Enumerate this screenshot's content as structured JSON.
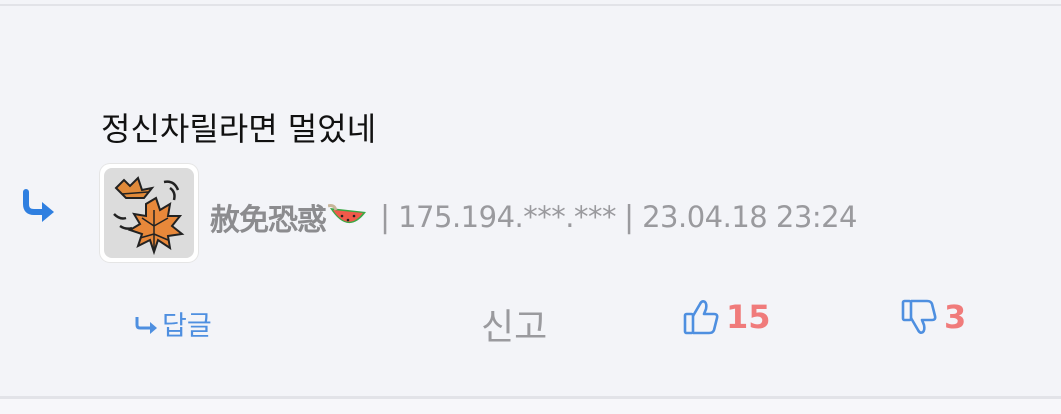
{
  "comment": {
    "text": "정신차릴라면 멀었네",
    "author": {
      "nickname": "赦免恐惑",
      "avatar_icon": "autumn-leaves-icon",
      "badge_icon": "watermelon-icon"
    },
    "ip": "175.194.***.***",
    "datetime": "23.04.18 23:24",
    "separator": "|"
  },
  "actions": {
    "reply_label": "답글",
    "report_label": "신고",
    "like_count": "15",
    "dislike_count": "3"
  },
  "colors": {
    "background": "#f3f4f8",
    "accent_blue": "#4e8fe0",
    "count_red": "#f07b7b",
    "meta_gray": "#9a9a9e"
  }
}
